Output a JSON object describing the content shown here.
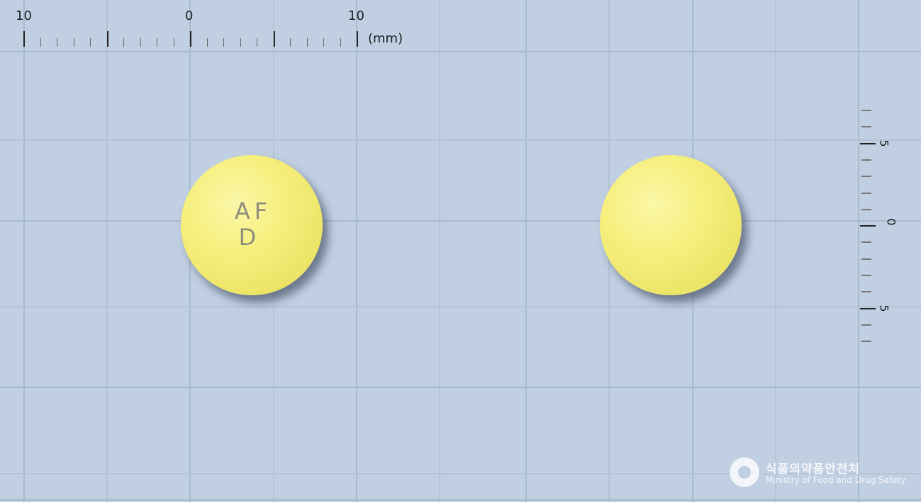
{
  "ruler_top": {
    "labels": [
      "10",
      "0",
      "10"
    ],
    "unit": "(mm)"
  },
  "ruler_right": {
    "labels": [
      "5",
      "0",
      "5"
    ]
  },
  "pill_front": {
    "imprint_line1": "AF",
    "imprint_line2": "D",
    "color": "#f4ed7a"
  },
  "pill_back": {
    "imprint": "",
    "color": "#f4ed7a"
  },
  "logo": {
    "korean": "식품의약품안전처",
    "english": "Ministry of Food and Drug Safety"
  },
  "colors": {
    "background": "#c0cfe2",
    "grid": "#a9b9cc"
  }
}
